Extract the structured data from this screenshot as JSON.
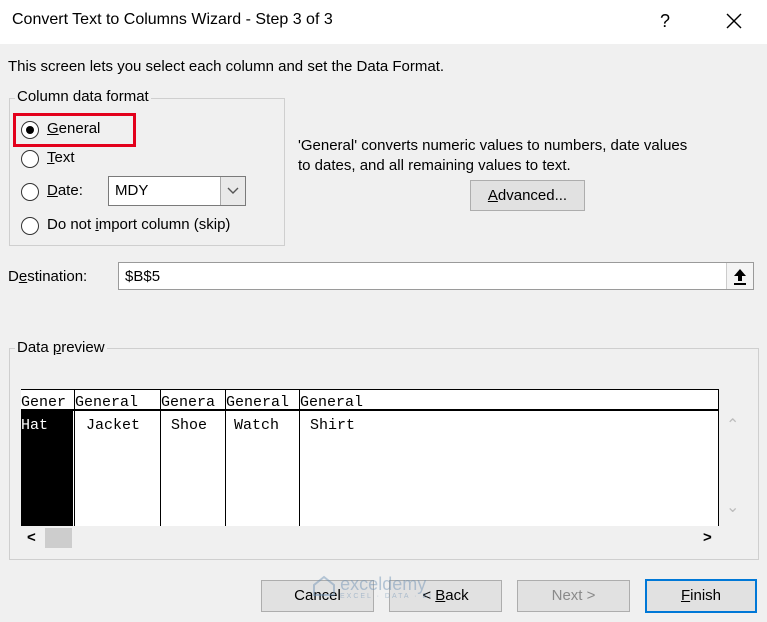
{
  "window": {
    "title": "Convert Text to Columns Wizard - Step 3 of 3",
    "help_label": "?"
  },
  "intro": "This screen lets you select each column and set the Data Format.",
  "column_format": {
    "legend": "Column data format",
    "options": [
      {
        "pre": "",
        "key": "G",
        "post": "eneral",
        "selected": true
      },
      {
        "pre": "",
        "key": "T",
        "post": "ext",
        "selected": false
      },
      {
        "pre": "",
        "key": "D",
        "post": "ate:",
        "selected": false
      },
      {
        "pre": "Do not ",
        "key": "i",
        "post": "mport column (skip)",
        "selected": false
      }
    ],
    "date_value": "MDY"
  },
  "description": {
    "line1": "'General' converts numeric values to numbers, date values",
    "line2": "to dates, and all remaining values to text."
  },
  "advanced_button": {
    "key": "A",
    "post": "dvanced..."
  },
  "destination": {
    "pre": "D",
    "key": "e",
    "post": "stination:",
    "value": "$B$5"
  },
  "data_preview": {
    "legend_pre": "Data ",
    "legend_key": "p",
    "legend_post": "review",
    "headers": [
      "Gener",
      "General",
      "Genera",
      "General",
      "General"
    ],
    "row": [
      "Hat",
      "Jacket",
      "Shoe",
      "Watch",
      "Shirt"
    ]
  },
  "scroll": {
    "up": "⌃",
    "down": "⌄",
    "left": "<",
    "right": ">"
  },
  "watermark": {
    "brand": "exceldemy",
    "tagline": "EXCEL · DATA · BI"
  },
  "buttons": {
    "cancel": "Cancel",
    "back_pre": "< ",
    "back_key": "B",
    "back_post": "ack",
    "next": "Next >",
    "finish_key": "F",
    "finish_post": "inish"
  },
  "colors": {
    "highlight": "#e3001b",
    "default_button": "#0078d7"
  }
}
